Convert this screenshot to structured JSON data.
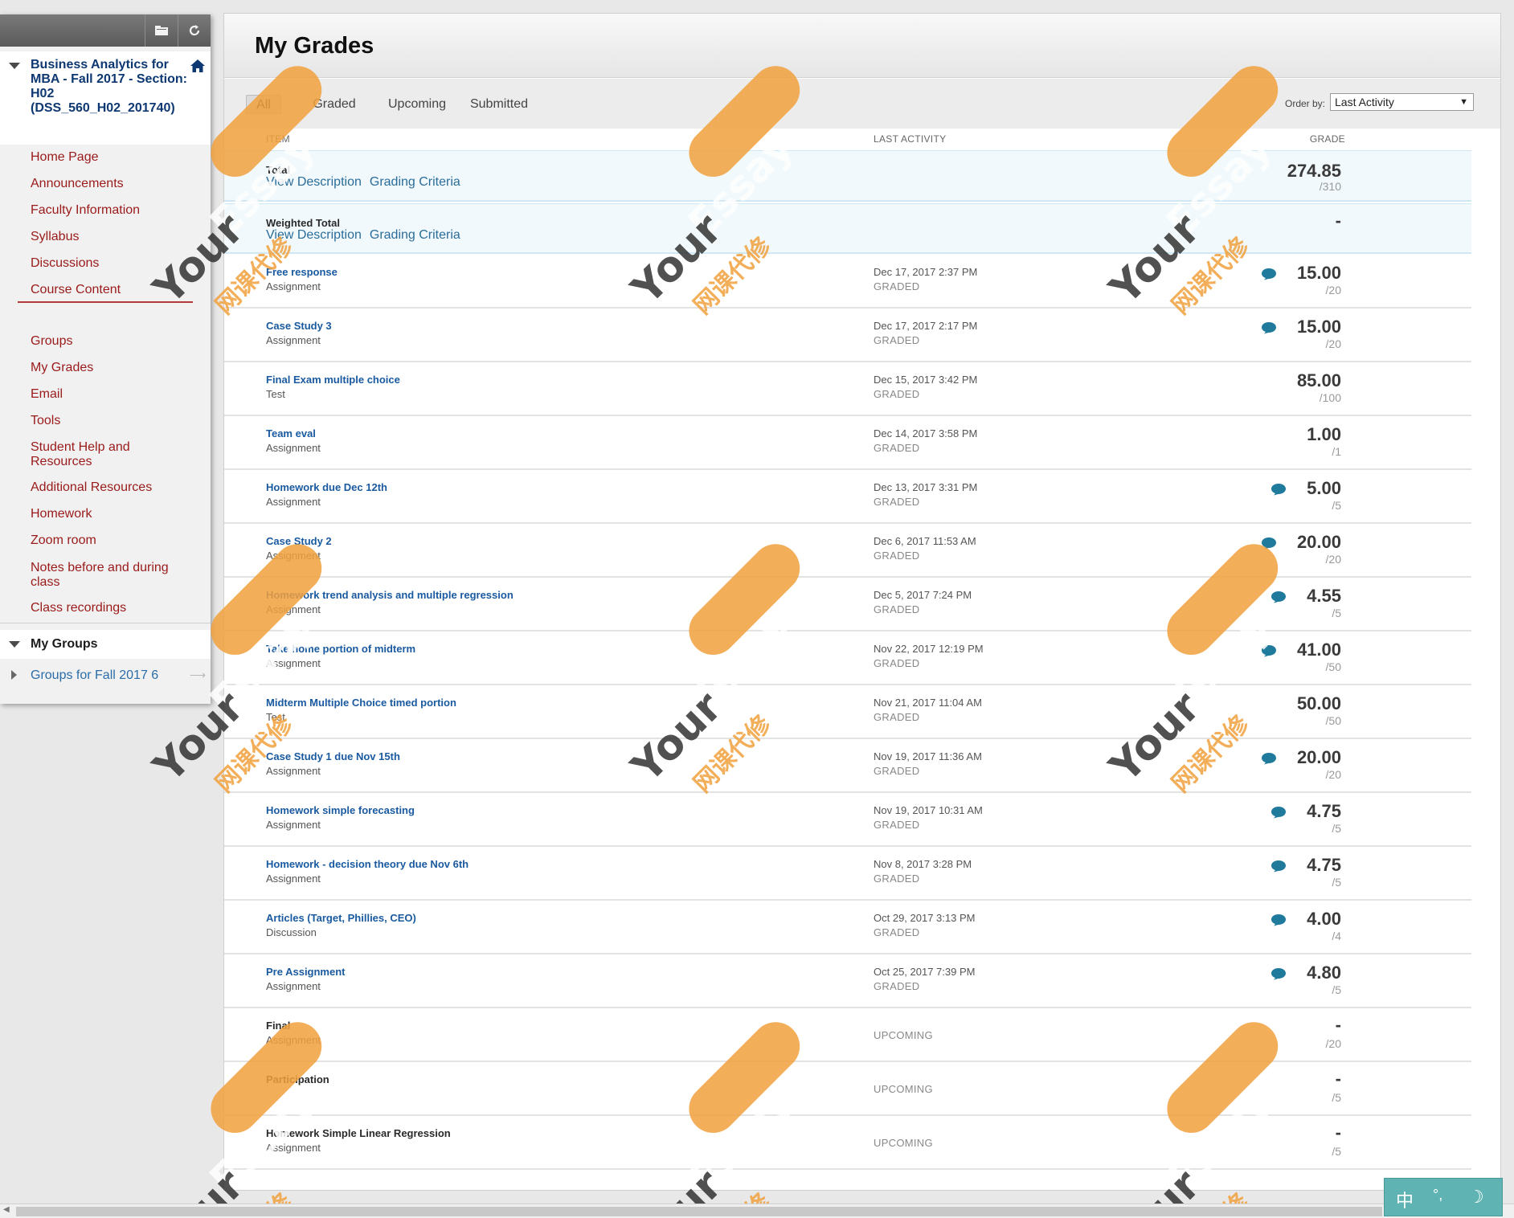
{
  "sidebar": {
    "course_title": "Business Analytics for MBA - Fall 2017 - Section: H02 (DSS_560_H02_201740)",
    "nav": [
      {
        "label": "Home Page",
        "name": "home-page"
      },
      {
        "label": "Announcements",
        "name": "announcements"
      },
      {
        "label": "Faculty Information",
        "name": "faculty-information"
      },
      {
        "label": "Syllabus",
        "name": "syllabus"
      },
      {
        "label": "Discussions",
        "name": "discussions"
      },
      {
        "label": "Course Content",
        "name": "course-content"
      },
      {
        "label": "Groups",
        "name": "groups"
      },
      {
        "label": "My Grades",
        "name": "my-grades"
      },
      {
        "label": "Email",
        "name": "email"
      },
      {
        "label": "Tools",
        "name": "tools"
      },
      {
        "label": "Student Help and Resources",
        "name": "student-help"
      },
      {
        "label": "Additional Resources",
        "name": "additional-resources"
      },
      {
        "label": "Homework",
        "name": "homework"
      },
      {
        "label": "Zoom room",
        "name": "zoom-room"
      },
      {
        "label": "Notes before and during class",
        "name": "notes-before-class"
      },
      {
        "label": "Class recordings",
        "name": "class-recordings"
      }
    ],
    "my_groups_title": "My Groups",
    "groups_link": "Groups for Fall 2017 6"
  },
  "main": {
    "title": "My Grades",
    "filter_tabs": [
      "All",
      "Graded",
      "Upcoming",
      "Submitted"
    ],
    "order_by_label": "Order by:",
    "order_by_value": "Last Activity",
    "columns": {
      "item": "ITEM",
      "last_activity": "LAST ACTIVITY",
      "grade": "GRADE"
    },
    "view_description": "View Description",
    "grading_criteria": "Grading Criteria",
    "totals": [
      {
        "title": "Total",
        "score": "274.85",
        "outof": "/310"
      },
      {
        "title": "Weighted Total",
        "score": "-",
        "outof": ""
      }
    ],
    "items": [
      {
        "title": "Free response",
        "type": "Assignment",
        "date": "Dec 17, 2017 2:37 PM",
        "status": "GRADED",
        "score": "15.00",
        "outof": "/20",
        "comment": true,
        "link": true
      },
      {
        "title": "Case Study 3",
        "type": "Assignment",
        "date": "Dec 17, 2017 2:17 PM",
        "status": "GRADED",
        "score": "15.00",
        "outof": "/20",
        "comment": true,
        "link": true
      },
      {
        "title": "Final Exam multiple choice",
        "type": "Test",
        "date": "Dec 15, 2017 3:42 PM",
        "status": "GRADED",
        "score": "85.00",
        "outof": "/100",
        "comment": false,
        "link": true
      },
      {
        "title": "Team eval",
        "type": "Assignment",
        "date": "Dec 14, 2017 3:58 PM",
        "status": "GRADED",
        "score": "1.00",
        "outof": "/1",
        "comment": false,
        "link": true
      },
      {
        "title": "Homework due Dec 12th",
        "type": "Assignment",
        "date": "Dec 13, 2017 3:31 PM",
        "status": "GRADED",
        "score": "5.00",
        "outof": "/5",
        "comment": true,
        "link": true
      },
      {
        "title": "Case Study 2",
        "type": "Assignment",
        "date": "Dec 6, 2017 11:53 AM",
        "status": "GRADED",
        "score": "20.00",
        "outof": "/20",
        "comment": true,
        "link": true
      },
      {
        "title": "Homework trend analysis and multiple regression",
        "type": "Assignment",
        "date": "Dec 5, 2017 7:24 PM",
        "status": "GRADED",
        "score": "4.55",
        "outof": "/5",
        "comment": true,
        "link": true
      },
      {
        "title": "Take home portion of midterm",
        "type": "Assignment",
        "date": "Nov 22, 2017 12:19 PM",
        "status": "GRADED",
        "score": "41.00",
        "outof": "/50",
        "comment": true,
        "link": true
      },
      {
        "title": "Midterm Multiple Choice timed portion",
        "type": "Test",
        "date": "Nov 21, 2017 11:04 AM",
        "status": "GRADED",
        "score": "50.00",
        "outof": "/50",
        "comment": false,
        "link": true
      },
      {
        "title": "Case Study 1 due Nov 15th",
        "type": "Assignment",
        "date": "Nov 19, 2017 11:36 AM",
        "status": "GRADED",
        "score": "20.00",
        "outof": "/20",
        "comment": true,
        "link": true
      },
      {
        "title": "Homework simple forecasting",
        "type": "Assignment",
        "date": "Nov 19, 2017 10:31 AM",
        "status": "GRADED",
        "score": "4.75",
        "outof": "/5",
        "comment": true,
        "link": true
      },
      {
        "title": "Homework - decision theory due Nov 6th",
        "type": "Assignment",
        "date": "Nov 8, 2017 3:28 PM",
        "status": "GRADED",
        "score": "4.75",
        "outof": "/5",
        "comment": true,
        "link": true
      },
      {
        "title": "Articles (Target, Phillies, CEO)",
        "type": "Discussion",
        "date": "Oct 29, 2017 3:13 PM",
        "status": "GRADED",
        "score": "4.00",
        "outof": "/4",
        "comment": true,
        "link": true
      },
      {
        "title": "Pre Assignment",
        "type": "Assignment",
        "date": "Oct 25, 2017 7:39 PM",
        "status": "GRADED",
        "score": "4.80",
        "outof": "/5",
        "comment": true,
        "link": true
      },
      {
        "title": "Final",
        "type": "Assignment",
        "date": "",
        "status": "UPCOMING",
        "score": "-",
        "outof": "/20",
        "comment": false,
        "link": false
      },
      {
        "title": "Participation",
        "type": "",
        "date": "",
        "status": "UPCOMING",
        "score": "-",
        "outof": "/5",
        "comment": false,
        "link": false
      },
      {
        "title": "Homework Simple Linear Regression",
        "type": "Assignment",
        "date": "",
        "status": "UPCOMING",
        "score": "-",
        "outof": "/5",
        "comment": false,
        "link": false
      }
    ]
  },
  "watermark": {
    "brand": "Your",
    "brand_accent": "Essay",
    "cn": "网课代修"
  },
  "ime": {
    "lang": "中",
    "punct": "°,",
    "mode": "☽"
  },
  "colors": {
    "link": "#1a5aa0",
    "nav": "#9a1a1a",
    "comment_icon": "#1f7a9c",
    "watermark": "#f2a13e"
  }
}
